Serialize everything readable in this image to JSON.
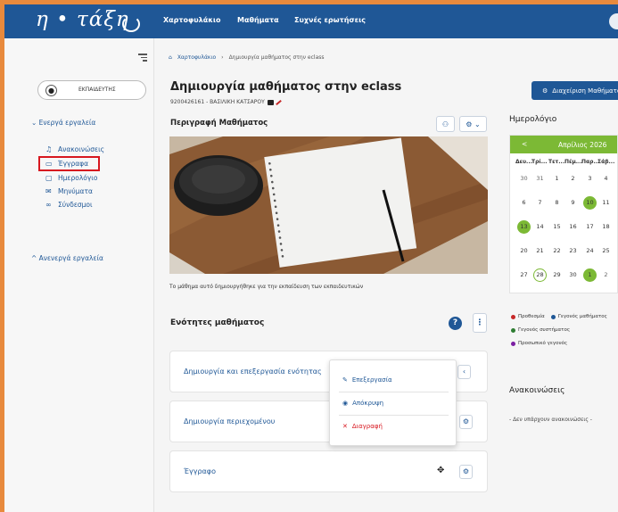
{
  "header": {
    "logo_text": "η • τάξη",
    "nav": [
      "Χαρτοφυλάκιο",
      "Μαθήματα",
      "Συχνές ερωτήσεις"
    ]
  },
  "sidebar": {
    "role": "ΕΚΠΑΙΔΕΥΤΗΣ",
    "active_section": "Ενεργά εργαλεία",
    "inactive_section": "Ανενεργά εργαλεία",
    "items": [
      {
        "icon": "bell-icon",
        "label": "Ανακοινώσεις"
      },
      {
        "icon": "folder-icon",
        "label": "Έγγραφα"
      },
      {
        "icon": "calendar-icon",
        "label": "Ημερολόγιο"
      },
      {
        "icon": "envelope-icon",
        "label": "Μηνύματα"
      },
      {
        "icon": "link-icon",
        "label": "Σύνδεσμοι"
      }
    ],
    "highlighted_item": "Έγγραφα"
  },
  "breadcrumb": {
    "home": "Χαρτοφυλάκιο",
    "current": "Δημιουργία μαθήματος στην eclass"
  },
  "course": {
    "title": "Δημιουργία μαθήματος στην eclass",
    "code": "9200426161 - ΒΑΣΙΛΙΚΗ ΚΑΤΣΑΡΟΥ",
    "description_heading": "Περιγραφή Μαθήματος",
    "description_text": "Το μάθημα αυτό δημιουργήθηκε για την εκπαίδευση των εκπαιδευτικών"
  },
  "units": {
    "heading": "Ενότητες μαθήματος",
    "items": [
      "Δημιουργία και επεξεργασία ενότητας",
      "Δημιουργία περιεχομένου",
      "Έγγραφο"
    ]
  },
  "dropdown": {
    "edit": "Επεξεργασία",
    "hide": "Απόκρυψη",
    "delete": "Διαγραφή"
  },
  "right": {
    "manage_button": "Διαχείριση Μαθήματος",
    "calendar_heading": "Ημερολόγιο",
    "month": "Απρίλιος 2026",
    "days_of_week": [
      "Δευ...",
      "Τρί...",
      "Τετ...",
      "Πέμ...",
      "Παρ...",
      "Σάβ..."
    ],
    "weeks": [
      [
        "30",
        "31",
        "1",
        "2",
        "3",
        "4"
      ],
      [
        "6",
        "7",
        "8",
        "9",
        "10",
        "11"
      ],
      [
        "13",
        "14",
        "15",
        "16",
        "17",
        "18"
      ],
      [
        "20",
        "21",
        "22",
        "23",
        "24",
        "25"
      ],
      [
        "27",
        "28",
        "29",
        "30",
        "1",
        "2"
      ]
    ],
    "legend": {
      "deadline": "Προθεσμία",
      "course_event": "Γεγονός μαθήματος",
      "system_event": "Γεγονός συστήματος",
      "personal_event": "Προσωπικό γεγονός"
    },
    "announcements_heading": "Ανακοινώσεις",
    "announcements_empty": "- Δεν υπάρχουν ανακοινώσεις -"
  },
  "colors": {
    "brand_blue": "#1f5796",
    "accent_green": "#7cb935",
    "highlight_red": "#d7171f",
    "frame_orange": "#e88a3d"
  }
}
